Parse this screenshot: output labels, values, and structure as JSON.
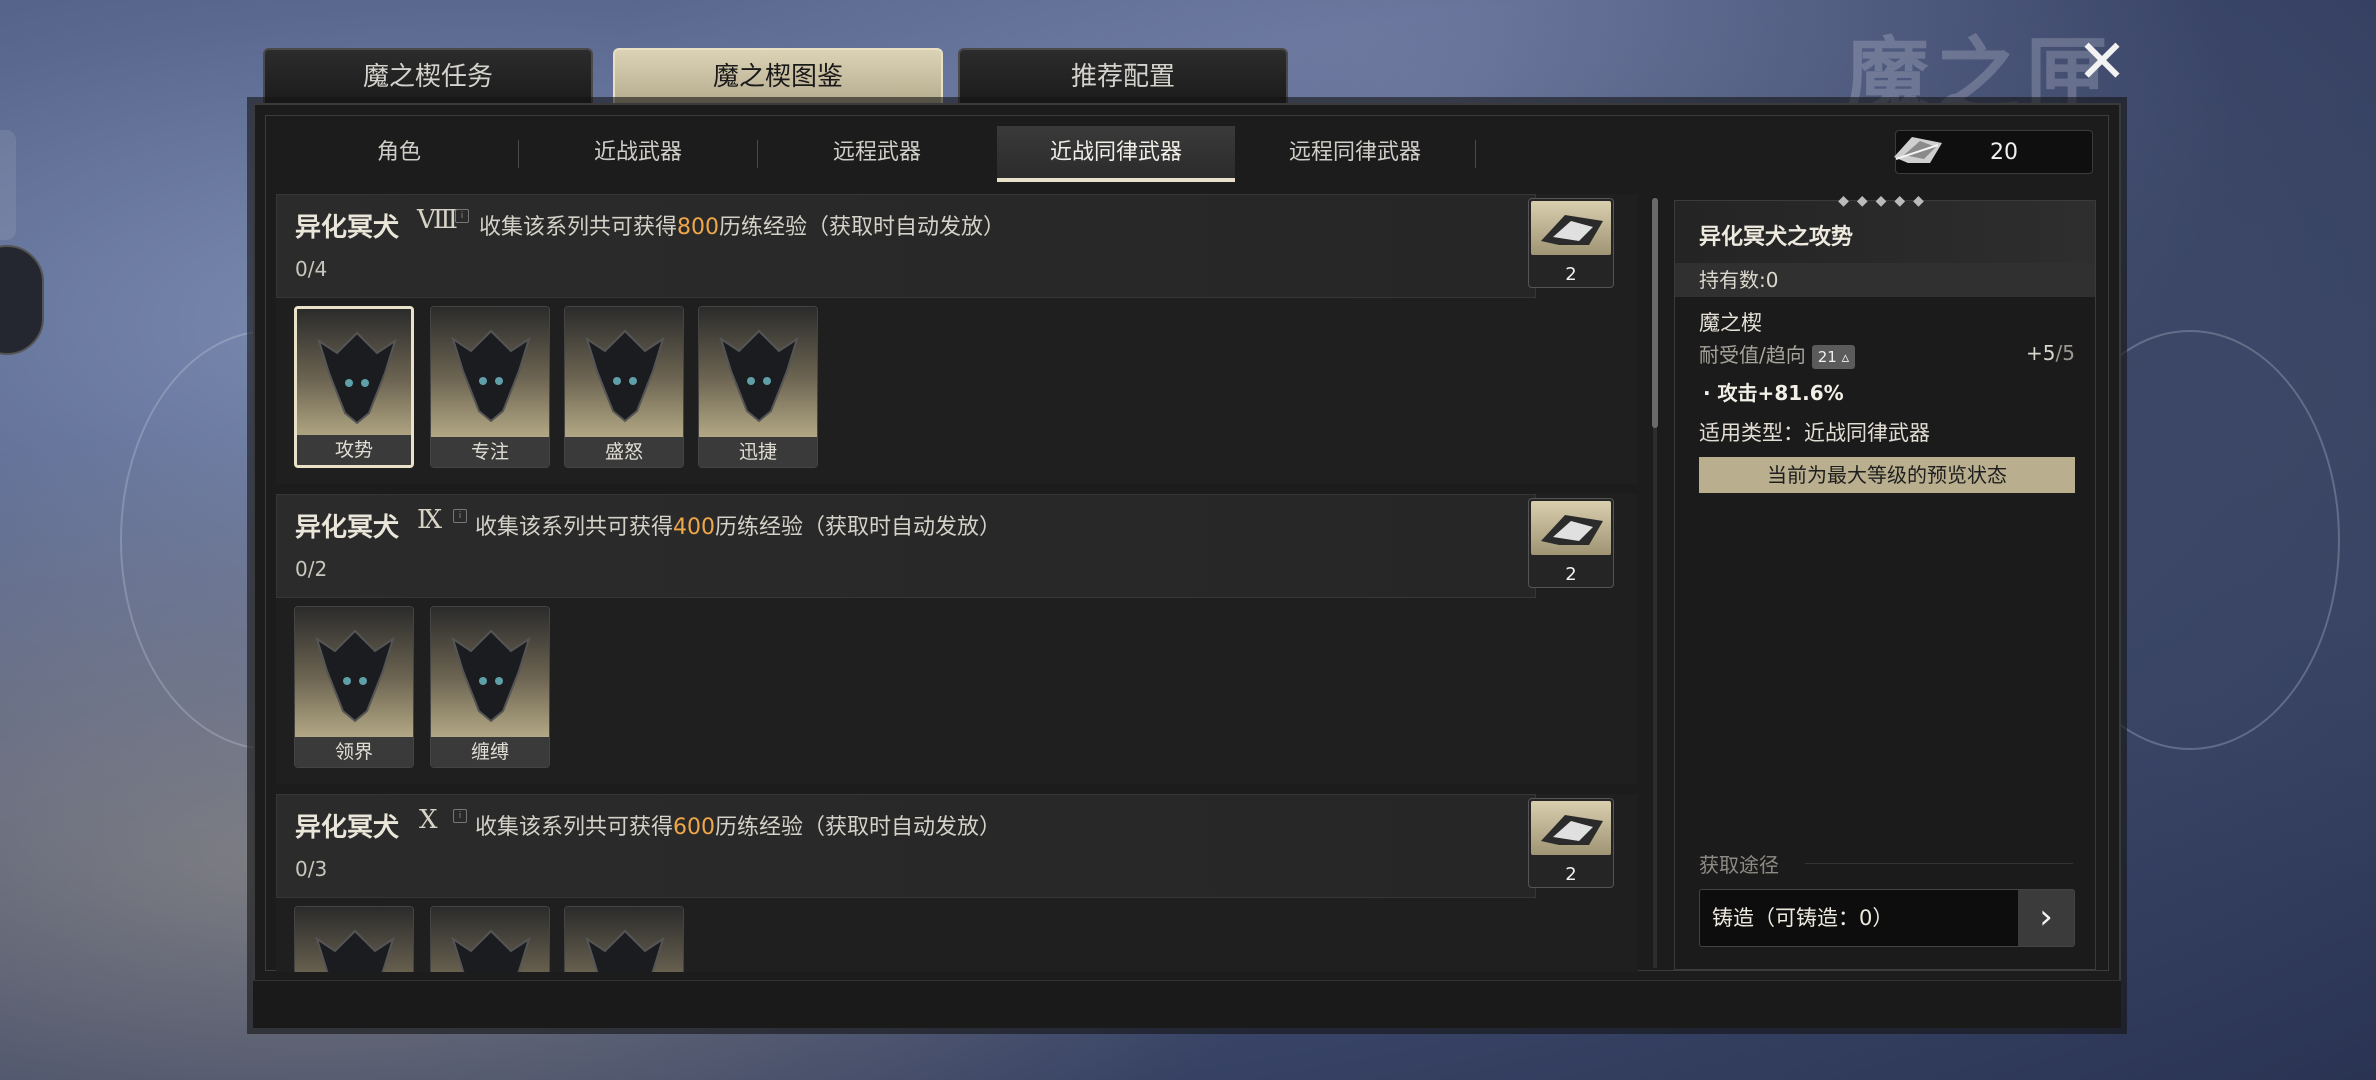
{
  "window": {
    "watermark": "魔之匣",
    "close_icon": "close-icon"
  },
  "top_tabs": [
    {
      "label": "魔之楔任务",
      "active": false
    },
    {
      "label": "魔之楔图鉴",
      "active": true
    },
    {
      "label": "推荐配置",
      "active": false
    }
  ],
  "sub_tabs": [
    {
      "label": "角色",
      "active": false
    },
    {
      "label": "近战武器",
      "active": false
    },
    {
      "label": "远程武器",
      "active": false
    },
    {
      "label": "近战同律武器",
      "active": true
    },
    {
      "label": "远程同律武器",
      "active": false
    }
  ],
  "currency": {
    "icon": "feather-token-icon",
    "value": "20"
  },
  "series": [
    {
      "name": "异化冥犬",
      "rank": "Ⅷ",
      "desc_prefix": "收集该系列共可获得",
      "desc_value": "800",
      "desc_suffix": "历练经验（获取时自动发放）",
      "progress": "0/4",
      "reward_count": "2",
      "cards": [
        "攻势",
        "专注",
        "盛怒",
        "迅捷"
      ]
    },
    {
      "name": "异化冥犬",
      "rank": "Ⅸ",
      "desc_prefix": "收集该系列共可获得",
      "desc_value": "400",
      "desc_suffix": "历练经验（获取时自动发放）",
      "progress": "0/2",
      "reward_count": "2",
      "cards": [
        "领界",
        "缠缚"
      ]
    },
    {
      "name": "异化冥犬",
      "rank": "Ⅹ",
      "desc_prefix": "收集该系列共可获得",
      "desc_value": "600",
      "desc_suffix": "历练经验（获取时自动发放）",
      "progress": "0/3",
      "reward_count": "2",
      "cards": [
        "",
        "",
        ""
      ]
    }
  ],
  "detail": {
    "title": "异化冥犬之攻势",
    "owned": "持有数:0",
    "type": "魔之楔",
    "durability_label": "耐受值/趋向",
    "durability_badge": "21",
    "durability_icon": "polarity-icon",
    "level_current": "+5",
    "level_max": "/5",
    "stat": "· 攻击+81.6%",
    "applicable": "适用类型：近战同律武器",
    "preview_notice": "当前为最大等级的预览状态",
    "acquire_label": "获取途径",
    "acquire_button": "铸造（可铸造：0）",
    "acquire_arrow": "›"
  },
  "colors": {
    "accent_gold": "#f0a74a",
    "active_tab": "#dcd3b6",
    "preview_bar": "#b9ae8e"
  }
}
